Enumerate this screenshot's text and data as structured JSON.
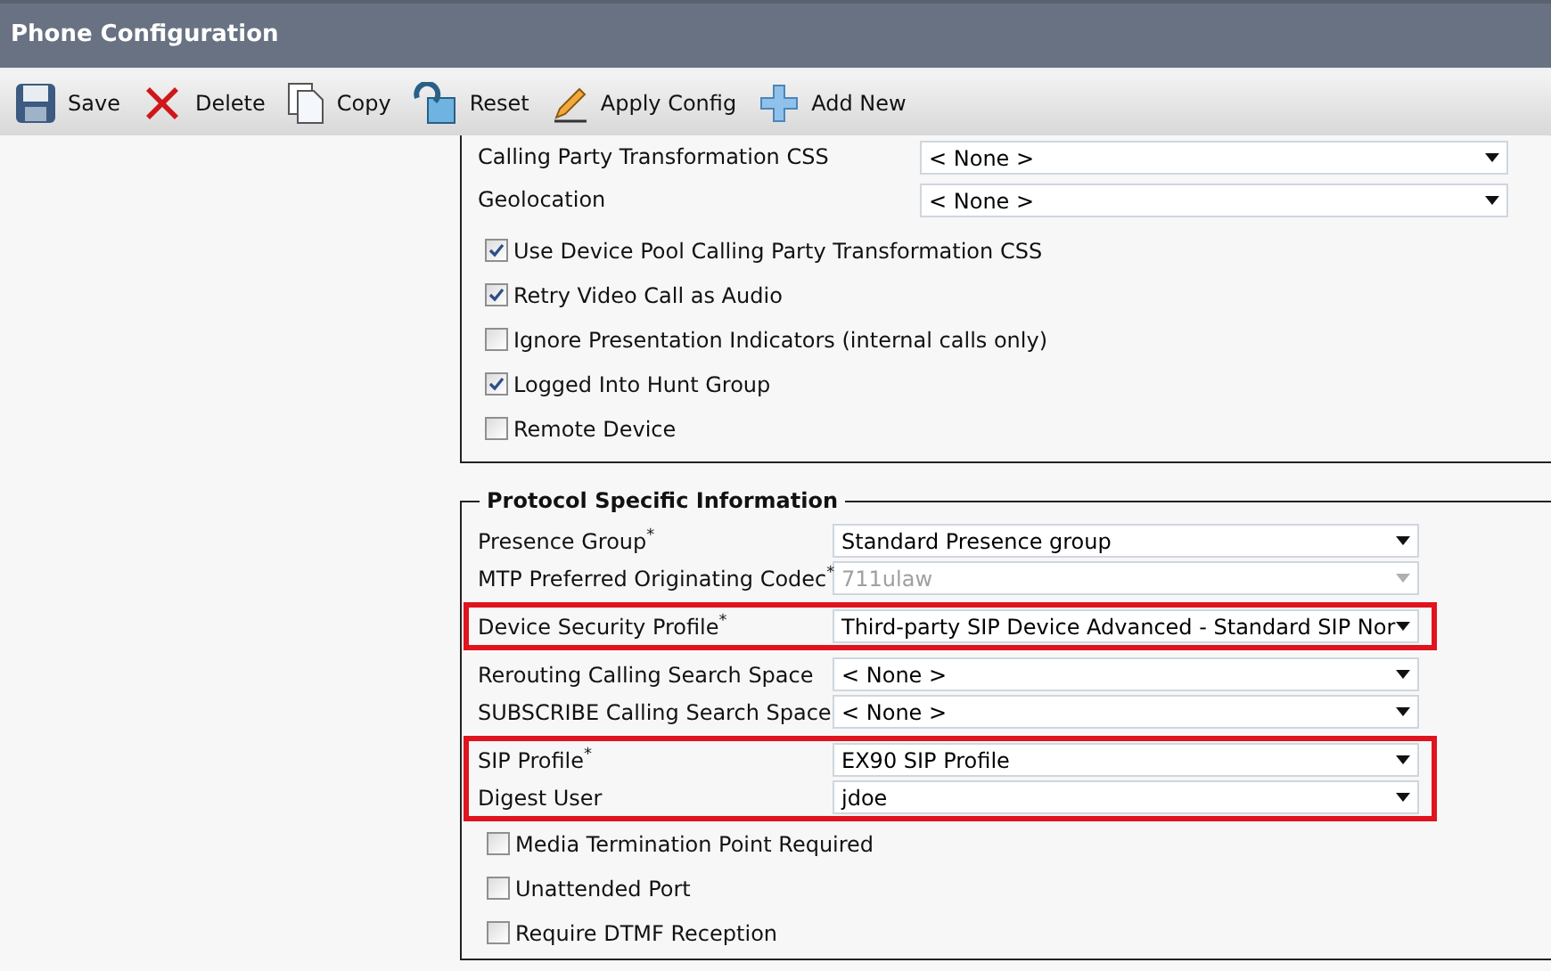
{
  "window": {
    "title": "Phone Configuration"
  },
  "toolbar": [
    {
      "kind": "save",
      "label": "Save"
    },
    {
      "kind": "delete",
      "label": "Delete"
    },
    {
      "kind": "copy",
      "label": "Copy"
    },
    {
      "kind": "reset",
      "label": "Reset"
    },
    {
      "kind": "apply",
      "label": "Apply Config"
    },
    {
      "kind": "add",
      "label": "Add New"
    }
  ],
  "upper_section": {
    "fields": [
      {
        "label": "Calling Party Transformation CSS",
        "value": "< None >"
      },
      {
        "label": "Geolocation",
        "value": "< None >"
      }
    ],
    "checkboxes": [
      {
        "label": "Use Device Pool Calling Party Transformation CSS",
        "checked": true
      },
      {
        "label": "Retry Video Call as Audio",
        "checked": true
      },
      {
        "label": "Ignore Presentation Indicators (internal calls only)",
        "checked": false
      },
      {
        "label": "Logged Into Hunt Group",
        "checked": true
      },
      {
        "label": "Remote Device",
        "checked": false
      }
    ]
  },
  "protocol_section": {
    "title": "Protocol Specific Information",
    "field_groups": [
      {
        "highlighted": false,
        "fields": [
          {
            "label": "Presence Group$^{*}$",
            "value": "Standard Presence group",
            "disabled": false
          },
          {
            "label": "MTP Preferred Originating Codec$^{*}$",
            "value": "711ulaw",
            "disabled": true
          }
        ]
      },
      {
        "highlighted": true,
        "fields": [
          {
            "label": "Device Security Profile$^{*}$",
            "value": "Third-party SIP Device Advanced - Standard SIP Nor",
            "disabled": false
          }
        ]
      },
      {
        "highlighted": false,
        "fields": [
          {
            "label": "Rerouting Calling Search Space",
            "value": "< None >",
            "disabled": false
          },
          {
            "label": "SUBSCRIBE Calling Search Space",
            "value": "< None >",
            "disabled": false
          }
        ]
      },
      {
        "highlighted": true,
        "fields": [
          {
            "label": "SIP Profile$^{*}$",
            "value": "EX90 SIP Profile",
            "disabled": false
          },
          {
            "label": "Digest User",
            "value": "jdoe",
            "disabled": false
          }
        ]
      }
    ],
    "checkboxes": [
      {
        "label": "Media Termination Point Required",
        "checked": false
      },
      {
        "label": "Unattended Port",
        "checked": false
      },
      {
        "label": "Require DTMF Reception",
        "checked": false
      }
    ]
  }
}
